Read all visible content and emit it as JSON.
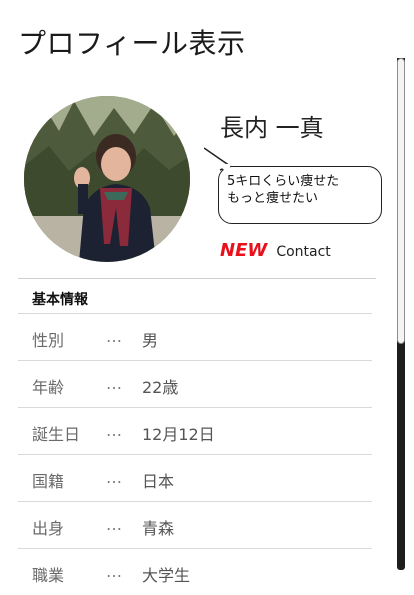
{
  "header": {
    "title": "プロフィール表示"
  },
  "profile": {
    "name": "長内 一真",
    "avatar_icon": "profile-photo",
    "status_bubble": {
      "line1": "5キロくらい痩せた",
      "line2": "もっと痩せたい"
    },
    "new_badge": "NEW",
    "contact_label": "Contact"
  },
  "basic_info": {
    "section_title": "基本情報",
    "separator": "…",
    "rows": [
      {
        "label": "性別",
        "value": "男"
      },
      {
        "label": "年齢",
        "value": "22歳"
      },
      {
        "label": "誕生日",
        "value": "12月12日"
      },
      {
        "label": "国籍",
        "value": "日本"
      },
      {
        "label": "出身",
        "value": "青森"
      },
      {
        "label": "職業",
        "value": "大学生"
      }
    ]
  },
  "colors": {
    "accent_new": "#e8111b",
    "divider": "#d9d9d9",
    "text_muted": "#6a6a6a"
  }
}
